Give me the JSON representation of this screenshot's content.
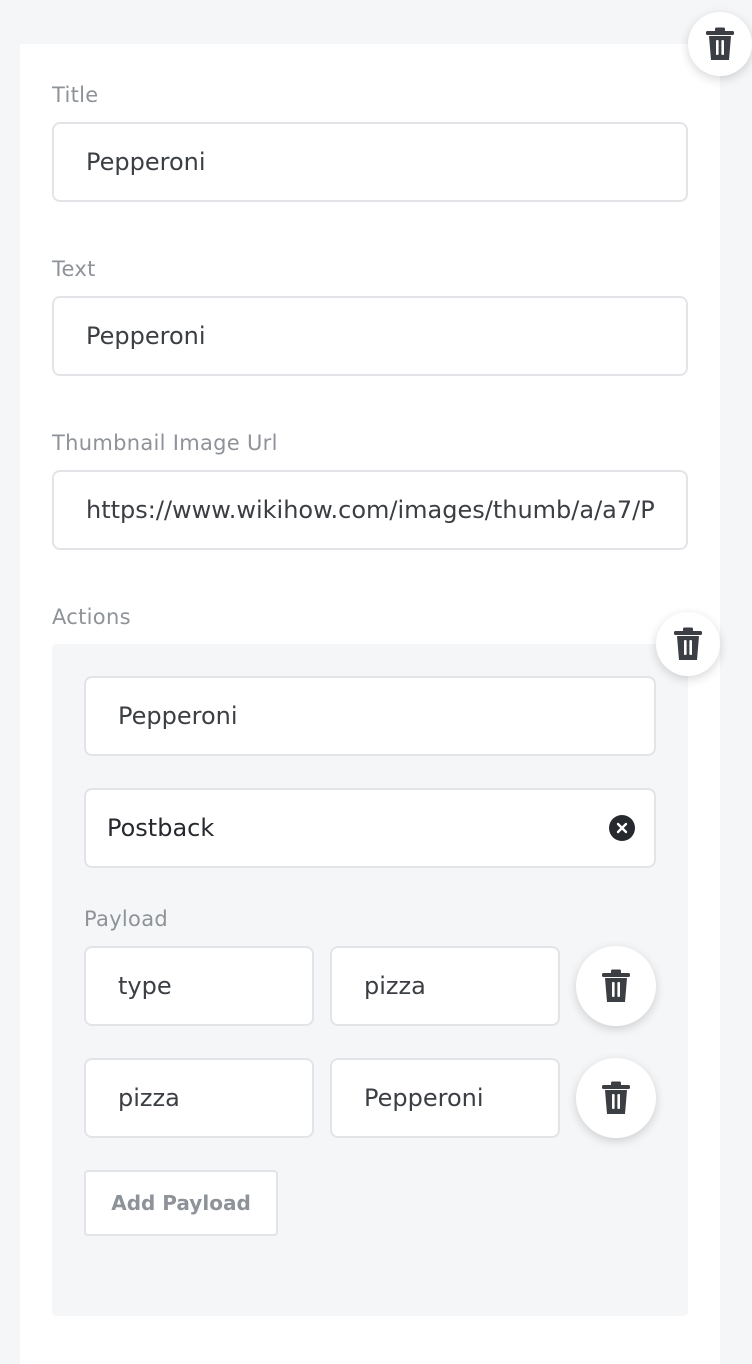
{
  "card": {
    "title": {
      "label": "Title",
      "value": "Pepperoni"
    },
    "text": {
      "label": "Text",
      "value": "Pepperoni"
    },
    "thumbnail": {
      "label": "Thumbnail Image Url",
      "value": "https://www.wikihow.com/images/thumb/a/a7/P"
    },
    "actions_label": "Actions"
  },
  "action": {
    "label_value": "Pepperoni",
    "type_value": "Postback",
    "payload_label": "Payload",
    "payload": [
      {
        "key": "type",
        "value": "pizza"
      },
      {
        "key": "pizza",
        "value": "Pepperoni"
      }
    ],
    "add_payload_label": "Add Payload"
  },
  "icons": {
    "delete": "trash-icon",
    "clear": "clear-icon"
  },
  "colors": {
    "background": "#f5f6f8",
    "label": "#8e9399",
    "border": "#e2e4e7",
    "text": "#3b3f44",
    "icon": "#3b3f44"
  }
}
